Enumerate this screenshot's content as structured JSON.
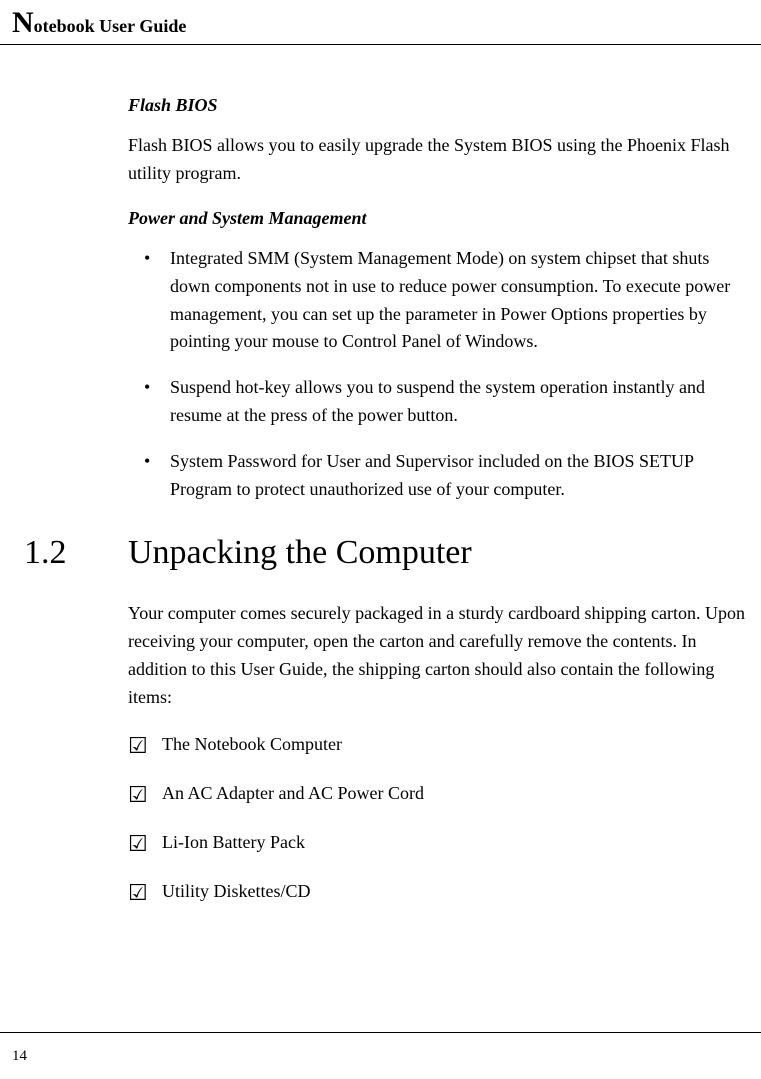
{
  "header": {
    "title_prefix": "N",
    "title_rest": "otebook User Guide"
  },
  "sections": {
    "flash_bios": {
      "heading": "Flash BIOS",
      "paragraph": "Flash BIOS allows you to easily upgrade the System BIOS using the Phoenix Flash utility program."
    },
    "power_mgmt": {
      "heading": "Power and System Management",
      "bullets": [
        "Integrated SMM (System Management Mode) on system chipset that shuts down components not in use to reduce power consumption. To execute power management, you can set up the parameter in Power Options properties by pointing your mouse to Control Panel of Windows.",
        "Suspend hot-key allows you to suspend the system operation instantly and resume at the press of the power button.",
        "System Password for User and Supervisor included on the BIOS SETUP Program to protect unauthorized use of your computer."
      ]
    },
    "unpacking": {
      "number": "1.2",
      "title": "Unpacking the Computer",
      "paragraph": "Your computer comes securely packaged in a sturdy cardboard shipping carton. Upon receiving your computer, open the carton and carefully remove the contents. In addition to this User Guide, the shipping carton should also contain the following items:",
      "checklist": [
        "The Notebook Computer",
        "An AC Adapter and AC Power Cord",
        "Li-Ion Battery Pack",
        "Utility Diskettes/CD"
      ]
    }
  },
  "footer": {
    "page_number": "14"
  }
}
